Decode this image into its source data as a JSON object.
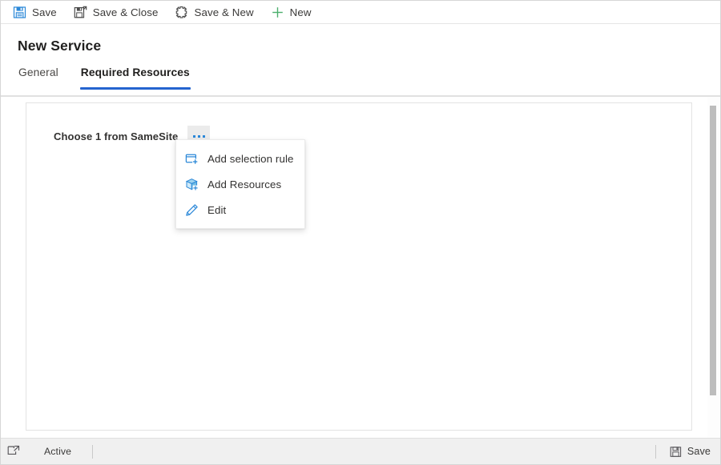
{
  "commandbar": {
    "buttons": [
      {
        "label": "Save",
        "icon": "save-icon"
      },
      {
        "label": "Save & Close",
        "icon": "save-and-close-icon"
      },
      {
        "label": "Save & New",
        "icon": "save-and-new-icon"
      },
      {
        "label": "New",
        "icon": "plus-icon"
      }
    ]
  },
  "header": {
    "title": "New Service",
    "tabs": [
      {
        "label": "General",
        "active": false
      },
      {
        "label": "Required Resources",
        "active": true
      }
    ]
  },
  "content": {
    "field_label": "Choose 1 from SameSite",
    "ellipsis_button_name": "more-options"
  },
  "context_menu": {
    "items": [
      {
        "label": "Add selection rule",
        "icon": "add-selection-rule-icon"
      },
      {
        "label": "Add Resources",
        "icon": "add-resources-icon"
      },
      {
        "label": "Edit",
        "icon": "pencil-icon"
      }
    ]
  },
  "footer": {
    "popout_icon": "popout-icon",
    "status": "Active",
    "save_label": "Save",
    "save_icon": "save-icon"
  },
  "colors": {
    "accent_blue": "#2564cf",
    "icon_blue": "#2b88d8",
    "new_green": "#4caf6d",
    "text_primary": "#201f1e",
    "text_secondary": "#3b3a39",
    "panel_border": "#e3e3e3",
    "footer_bg": "#f0f0f0",
    "scrollbar_thumb": "#bdbdbd"
  }
}
